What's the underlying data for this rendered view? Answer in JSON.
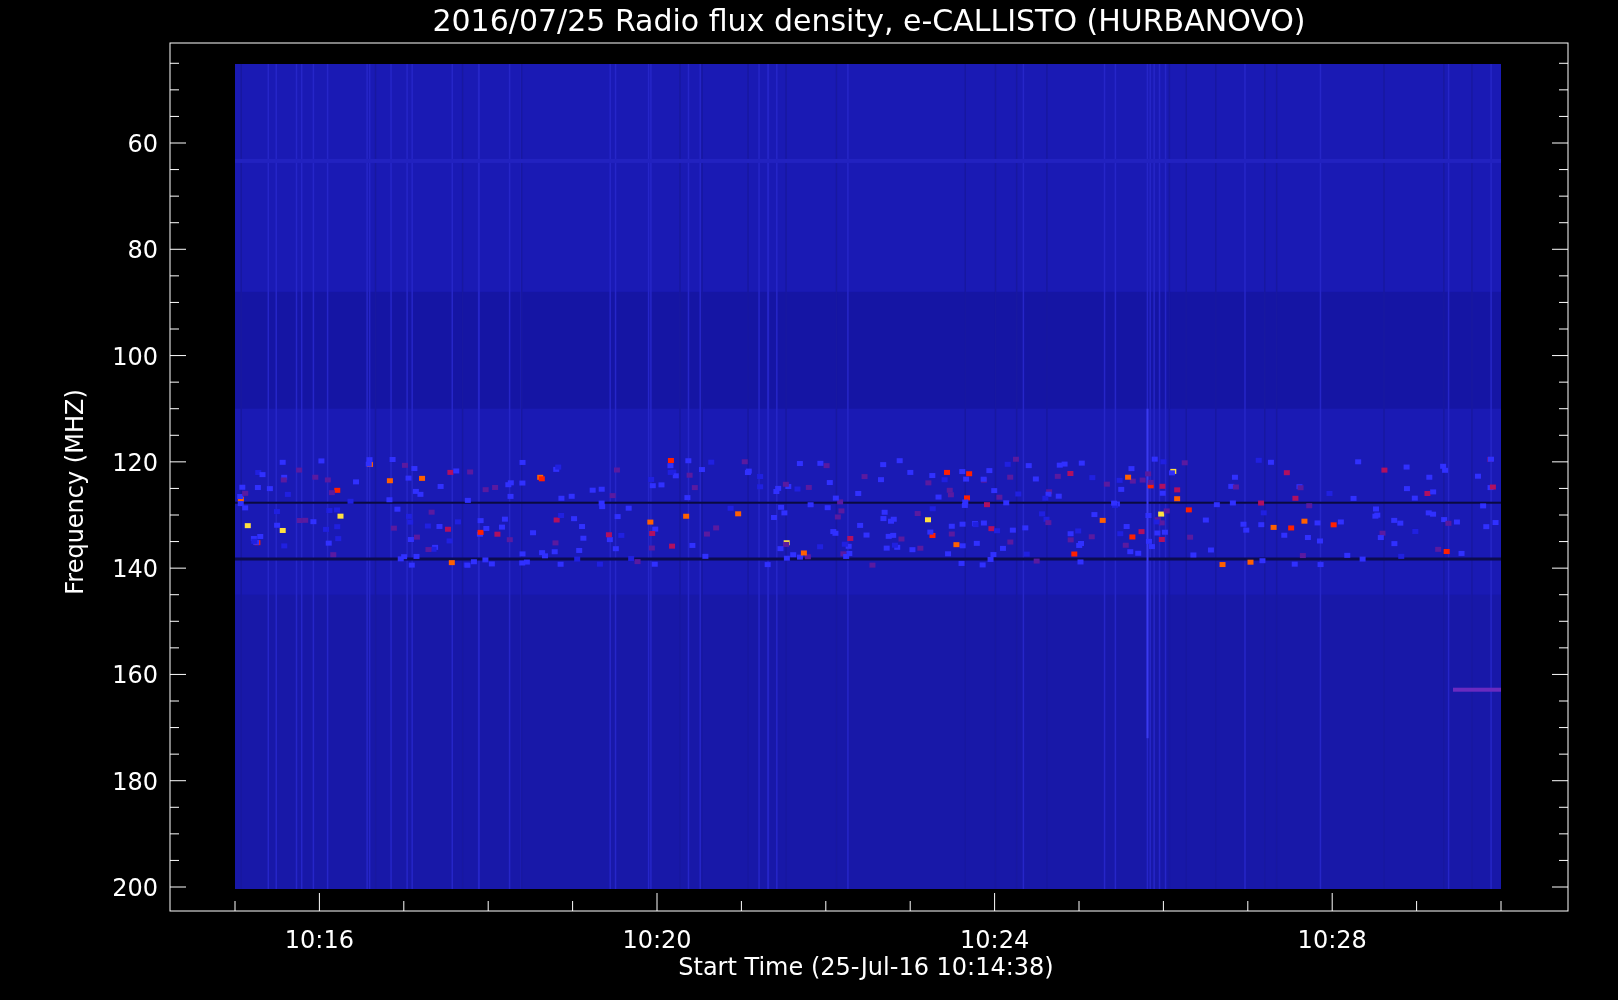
{
  "title": "2016/07/25  Radio flux density, e-CALLISTO (HURBANOVO)",
  "y_axis": {
    "label": "Frequency (MHZ)",
    "ticks": [
      "60",
      "80",
      "100",
      "120",
      "140",
      "160",
      "180",
      "200"
    ]
  },
  "x_axis": {
    "label": "Start Time (25-Jul-16 10:14:38)",
    "ticks": [
      "10:16",
      "10:20",
      "10:24",
      "10:28"
    ]
  }
}
